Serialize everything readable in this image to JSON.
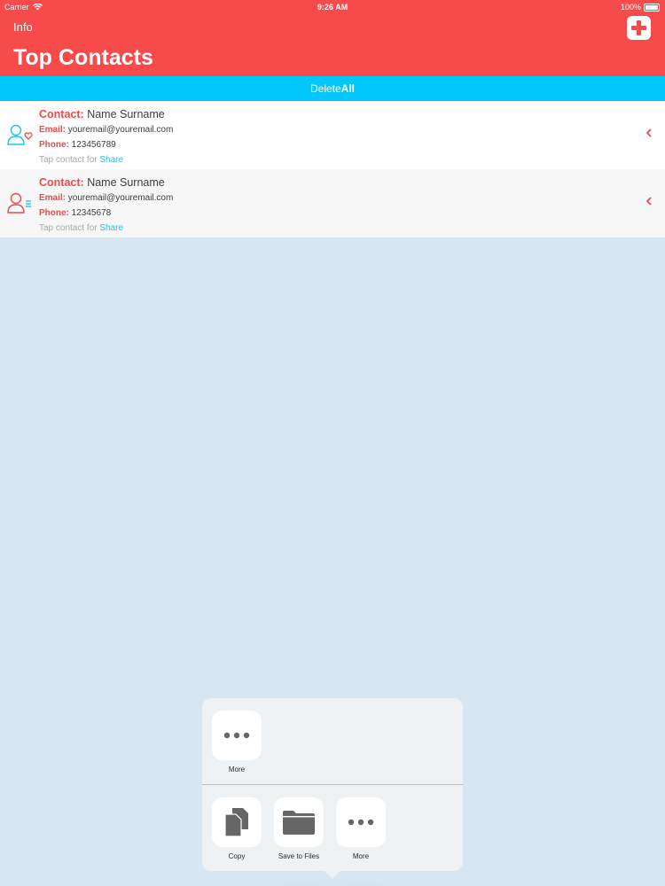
{
  "status_bar": {
    "carrier": "Carrier",
    "time": "9:26 AM",
    "battery": "100%"
  },
  "nav": {
    "info_label": "Info",
    "title": "Top Contacts",
    "add_icon": "plus-icon"
  },
  "delete_bar": {
    "prefix": "Delete",
    "suffix": "All"
  },
  "contacts": [
    {
      "contact_label": "Contact:",
      "name": "Name Surname",
      "email_label": "Email:",
      "email": "youremail@youremail.com",
      "phone_label": "Phone:",
      "phone": "123456789",
      "hint": "Tap contact for ",
      "share": "Share",
      "icon": "person-heart-icon"
    },
    {
      "contact_label": "Contact:",
      "name": "Name Surname",
      "email_label": "Email:",
      "email": "youremail@youremail.com",
      "phone_label": "Phone:",
      "phone": "12345678",
      "hint": "Tap contact for ",
      "share": "Share",
      "icon": "person-list-icon"
    }
  ],
  "share_sheet": {
    "top_row": [
      {
        "label": "More",
        "icon": "more-icon"
      }
    ],
    "bottom_row": [
      {
        "label": "Copy",
        "icon": "copy-icon"
      },
      {
        "label": "Save to Files",
        "icon": "folder-icon"
      },
      {
        "label": "More",
        "icon": "more-icon"
      }
    ]
  },
  "colors": {
    "nav_red": "#f74a4a",
    "delete_blue": "#00c8fa",
    "label_red": "#ee4a4a",
    "share_blue": "#1ec3f0",
    "avatar_blue": "#1ec3f0"
  }
}
